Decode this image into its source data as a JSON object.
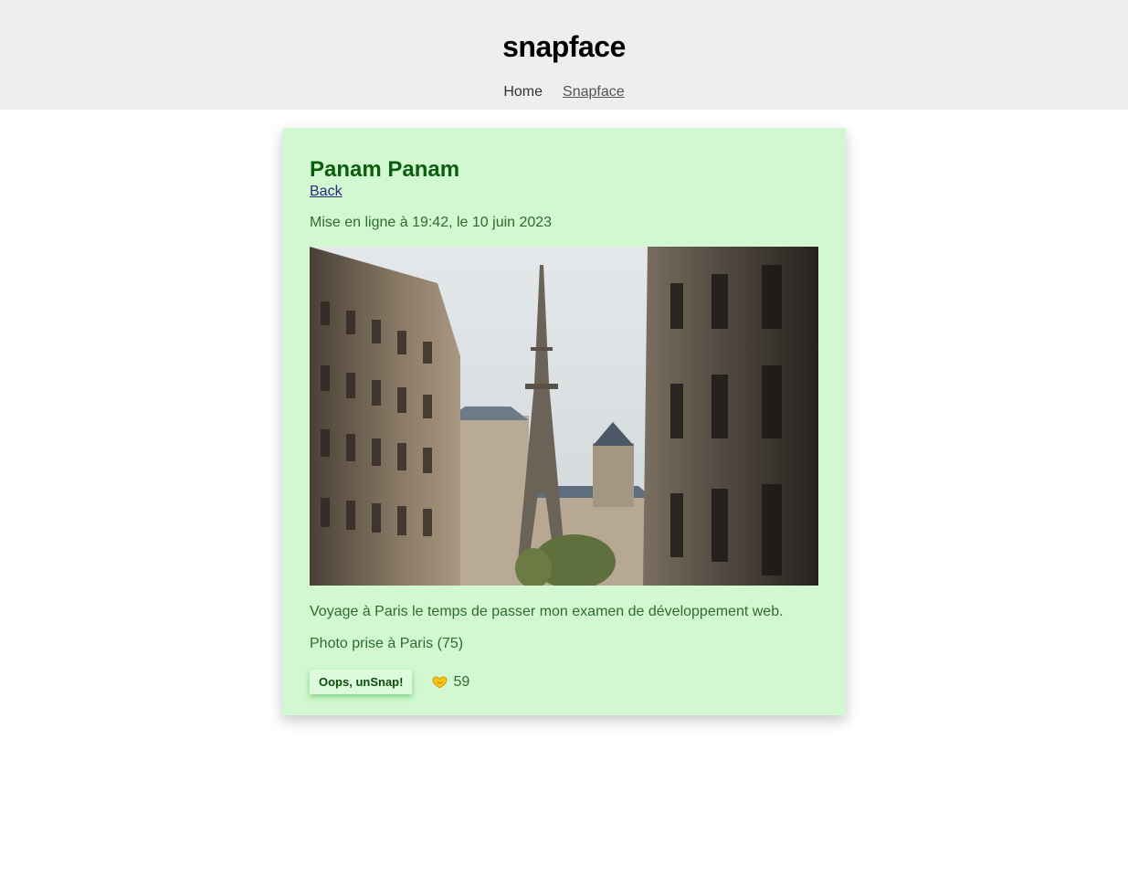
{
  "header": {
    "title": "snapface",
    "nav": [
      {
        "label": "Home"
      },
      {
        "label": "Snapface"
      }
    ]
  },
  "snap": {
    "title": "Panam Panam",
    "back_label": "Back",
    "date_text": "Mise en ligne à 19:42, le 10 juin 2023",
    "image_alt": "Eiffel Tower seen between Parisian buildings",
    "description": "Voyage à Paris le temps de passer mon examen de développement web.",
    "location_text": "Photo prise à Paris (75)",
    "unsnap_label": "Oops, unSnap!",
    "snap_count": "59",
    "icon": "heart-hands-icon"
  },
  "colors": {
    "header_bg": "#eeeeee",
    "card_bg": "#d2f8d2",
    "title_green": "#0c5d0c",
    "text_green": "#2f6b2f",
    "icon_yellow": "#f5c518"
  }
}
